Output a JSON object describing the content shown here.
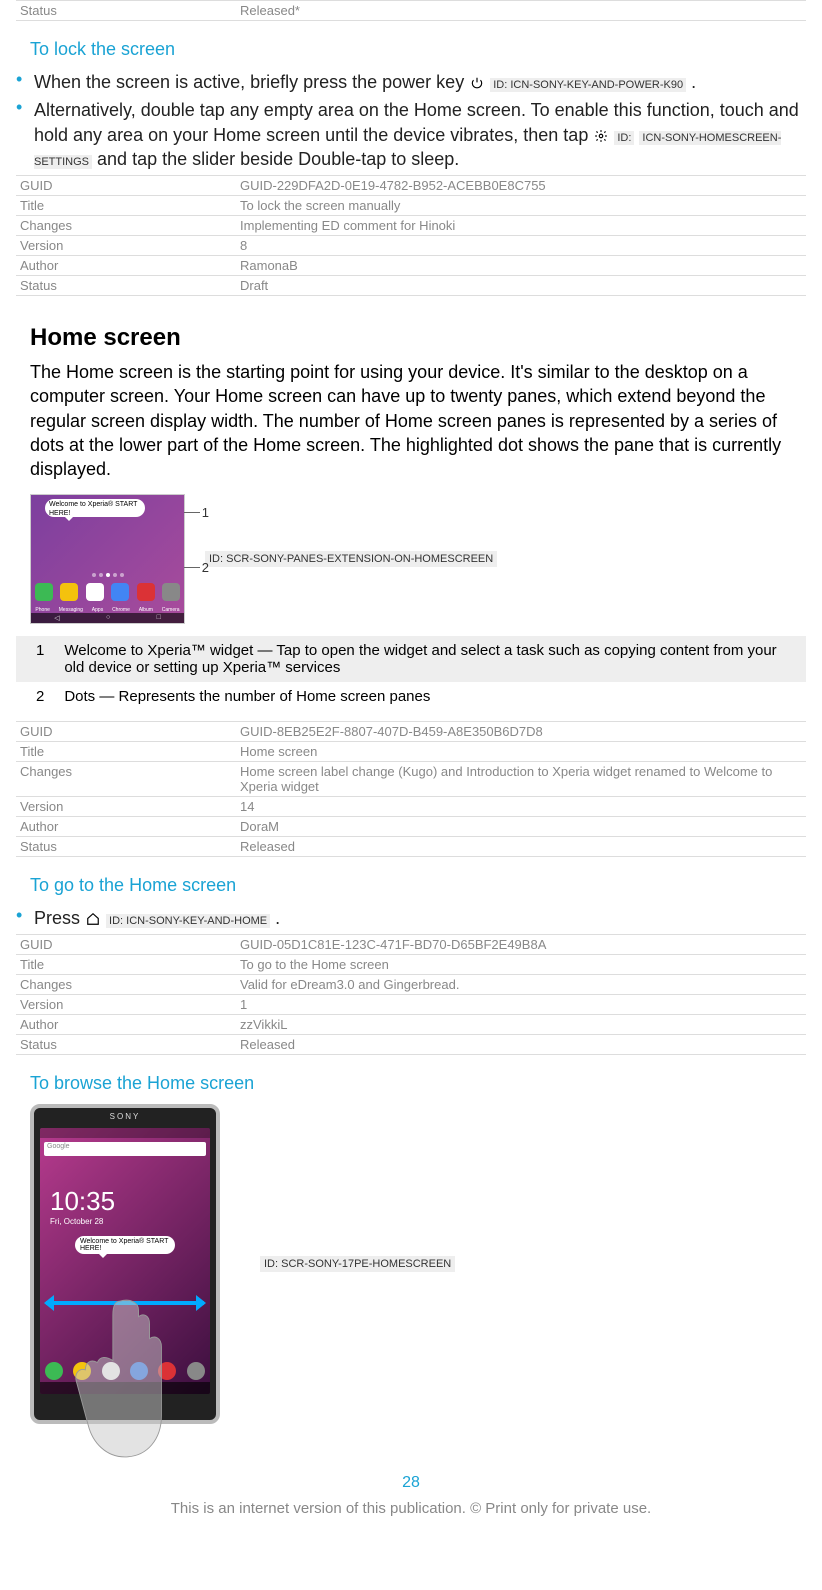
{
  "top_meta": {
    "status_k": "Status",
    "status_v": "Released*"
  },
  "sec1": {
    "heading": "To lock the screen",
    "b1_a": "When the screen is active, briefly press the power key ",
    "b1_id": "ID: ICN-SONY-KEY-AND-POWER-K90",
    "b1_c": ".",
    "b2_a": "Alternatively, double tap any empty area on the Home screen. To enable this function, touch and hold any area on your Home screen until the device vibrates, then tap ",
    "b2_id_a": "ID:",
    "b2_id_b": "ICN-SONY-HOMESCREEN-SETTINGS",
    "b2_c": " and tap the slider beside Double-tap to sleep."
  },
  "meta1": {
    "guid_k": "GUID",
    "guid_v": "GUID-229DFA2D-0E19-4782-B952-ACEBB0E8C755",
    "title_k": "Title",
    "title_v": "To lock the screen manually",
    "changes_k": "Changes",
    "changes_v": "Implementing ED comment for Hinoki",
    "version_k": "Version",
    "version_v": "8",
    "author_k": "Author",
    "author_v": "RamonaB",
    "status_k": "Status",
    "status_v": "Draft"
  },
  "sec2": {
    "heading": "Home screen",
    "para": "The Home screen is the starting point for using your device. It's similar to the desktop on a computer screen. Your Home screen can have up to twenty panes, which extend beyond the regular screen display width. The number of Home screen panes is represented by a series of dots at the lower part of the Home screen. The highlighted dot shows the pane that is currently displayed.",
    "fig_id": "ID: SCR-SONY-PANES-EXTENSION-ON-HOMESCREEN",
    "callout1": "1",
    "callout2": "2",
    "bubble": "Welcome to Xperia®\nSTART HERE!",
    "legend1_n": "1",
    "legend1_t": "Welcome to Xperia™ widget — Tap to open the widget and select a task such as copying content from your old device or setting up Xperia™ services",
    "legend2_n": "2",
    "legend2_t": "Dots — Represents the number of Home screen panes"
  },
  "meta2": {
    "guid_k": "GUID",
    "guid_v": "GUID-8EB25E2F-8807-407D-B459-A8E350B6D7D8",
    "title_k": "Title",
    "title_v": "Home screen",
    "changes_k": "Changes",
    "changes_v": "Home screen label change (Kugo) and Introduction to Xperia widget renamed to Welcome to Xperia widget",
    "version_k": "Version",
    "version_v": "14",
    "author_k": "Author",
    "author_v": "DoraM",
    "status_k": "Status",
    "status_v": "Released"
  },
  "sec3": {
    "heading": "To go to the Home screen",
    "b1_a": "Press ",
    "b1_id": "ID: ICN-SONY-KEY-AND-HOME",
    "b1_c": "."
  },
  "meta3": {
    "guid_k": "GUID",
    "guid_v": "GUID-05D1C81E-123C-471F-BD70-D65BF2E49B8A",
    "title_k": "Title",
    "title_v": "To go to the Home screen",
    "changes_k": "Changes",
    "changes_v": "Valid for eDream3.0 and Gingerbread.",
    "version_k": "Version",
    "version_v": "1",
    "author_k": "Author",
    "author_v": "zzVikkiL",
    "status_k": "Status",
    "status_v": "Released"
  },
  "sec4": {
    "heading": "To browse the Home screen",
    "fig_id": "ID: SCR-SONY-17PE-HOMESCREEN",
    "brand": "SONY",
    "search": "Google",
    "time": "10:35",
    "date": "Fri, October 28",
    "bubble": "Welcome to Xperia®\nSTART HERE!"
  },
  "page_num": "28",
  "footer": "This is an internet version of this publication. © Print only for private use."
}
